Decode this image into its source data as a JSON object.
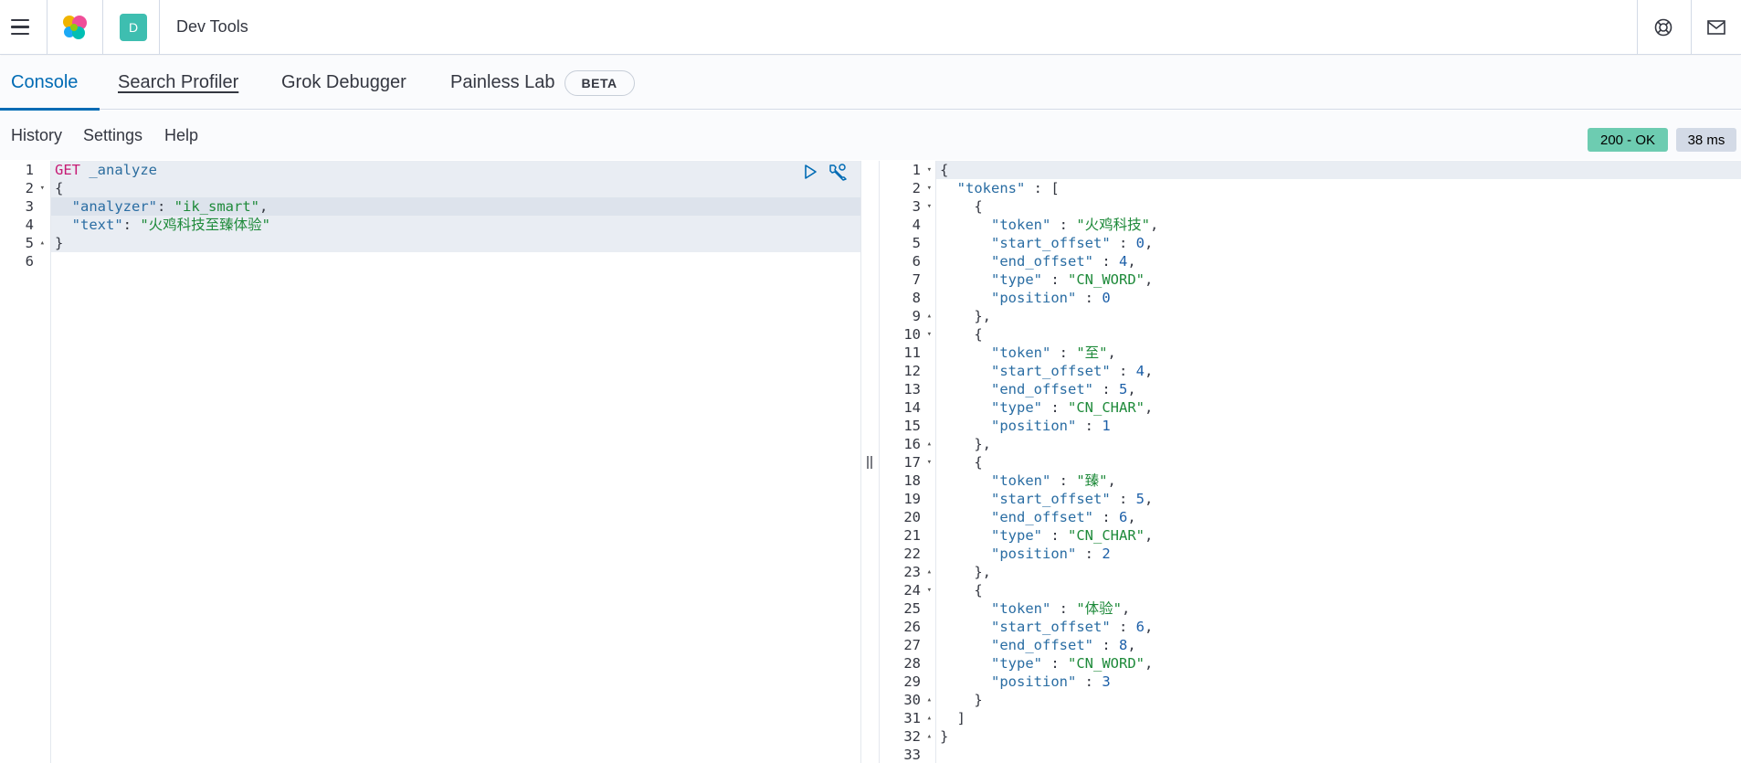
{
  "header": {
    "title": "Dev Tools",
    "space_initial": "D"
  },
  "tabs": [
    {
      "label": "Console",
      "active": true
    },
    {
      "label": "Search Profiler",
      "active": false
    },
    {
      "label": "Grok Debugger",
      "active": false
    },
    {
      "label": "Painless Lab",
      "active": false,
      "badge": "BETA"
    }
  ],
  "menu": {
    "history": "History",
    "settings": "Settings",
    "help": "Help"
  },
  "response_status": {
    "status": "200 - OK",
    "duration": "38 ms"
  },
  "colors": {
    "accent": "#006bb4",
    "status_ok": "#6dccb1",
    "space_avatar": "#3ebeb0"
  },
  "request_editor": {
    "lines": [
      [
        {
          "t": "GET",
          "c": "method"
        },
        {
          "t": " _analyze",
          "c": "path"
        }
      ],
      [
        {
          "t": "{",
          "c": "punc"
        }
      ],
      [
        {
          "t": "  ",
          "c": "punc"
        },
        {
          "t": "\"analyzer\"",
          "c": "key"
        },
        {
          "t": ": ",
          "c": "punc"
        },
        {
          "t": "\"ik_smart\"",
          "c": "str"
        },
        {
          "t": ",",
          "c": "punc"
        }
      ],
      [
        {
          "t": "  ",
          "c": "punc"
        },
        {
          "t": "\"text\"",
          "c": "key"
        },
        {
          "t": ": ",
          "c": "punc"
        },
        {
          "t": "\"火鸡科技至臻体验\"",
          "c": "str"
        }
      ],
      [
        {
          "t": "}",
          "c": "punc"
        }
      ],
      []
    ],
    "fold_lines": [
      2,
      5
    ]
  },
  "response_editor": {
    "lines": [
      [
        {
          "t": "{",
          "c": "punc"
        }
      ],
      [
        {
          "t": "  ",
          "c": "punc"
        },
        {
          "t": "\"tokens\"",
          "c": "key"
        },
        {
          "t": " : [",
          "c": "punc"
        }
      ],
      [
        {
          "t": "    {",
          "c": "punc"
        }
      ],
      [
        {
          "t": "      ",
          "c": "punc"
        },
        {
          "t": "\"token\"",
          "c": "key"
        },
        {
          "t": " : ",
          "c": "punc"
        },
        {
          "t": "\"火鸡科技\"",
          "c": "str"
        },
        {
          "t": ",",
          "c": "punc"
        }
      ],
      [
        {
          "t": "      ",
          "c": "punc"
        },
        {
          "t": "\"start_offset\"",
          "c": "key"
        },
        {
          "t": " : ",
          "c": "punc"
        },
        {
          "t": "0",
          "c": "num"
        },
        {
          "t": ",",
          "c": "punc"
        }
      ],
      [
        {
          "t": "      ",
          "c": "punc"
        },
        {
          "t": "\"end_offset\"",
          "c": "key"
        },
        {
          "t": " : ",
          "c": "punc"
        },
        {
          "t": "4",
          "c": "num"
        },
        {
          "t": ",",
          "c": "punc"
        }
      ],
      [
        {
          "t": "      ",
          "c": "punc"
        },
        {
          "t": "\"type\"",
          "c": "key"
        },
        {
          "t": " : ",
          "c": "punc"
        },
        {
          "t": "\"CN_WORD\"",
          "c": "str"
        },
        {
          "t": ",",
          "c": "punc"
        }
      ],
      [
        {
          "t": "      ",
          "c": "punc"
        },
        {
          "t": "\"position\"",
          "c": "key"
        },
        {
          "t": " : ",
          "c": "punc"
        },
        {
          "t": "0",
          "c": "num"
        }
      ],
      [
        {
          "t": "    },",
          "c": "punc"
        }
      ],
      [
        {
          "t": "    {",
          "c": "punc"
        }
      ],
      [
        {
          "t": "      ",
          "c": "punc"
        },
        {
          "t": "\"token\"",
          "c": "key"
        },
        {
          "t": " : ",
          "c": "punc"
        },
        {
          "t": "\"至\"",
          "c": "str"
        },
        {
          "t": ",",
          "c": "punc"
        }
      ],
      [
        {
          "t": "      ",
          "c": "punc"
        },
        {
          "t": "\"start_offset\"",
          "c": "key"
        },
        {
          "t": " : ",
          "c": "punc"
        },
        {
          "t": "4",
          "c": "num"
        },
        {
          "t": ",",
          "c": "punc"
        }
      ],
      [
        {
          "t": "      ",
          "c": "punc"
        },
        {
          "t": "\"end_offset\"",
          "c": "key"
        },
        {
          "t": " : ",
          "c": "punc"
        },
        {
          "t": "5",
          "c": "num"
        },
        {
          "t": ",",
          "c": "punc"
        }
      ],
      [
        {
          "t": "      ",
          "c": "punc"
        },
        {
          "t": "\"type\"",
          "c": "key"
        },
        {
          "t": " : ",
          "c": "punc"
        },
        {
          "t": "\"CN_CHAR\"",
          "c": "str"
        },
        {
          "t": ",",
          "c": "punc"
        }
      ],
      [
        {
          "t": "      ",
          "c": "punc"
        },
        {
          "t": "\"position\"",
          "c": "key"
        },
        {
          "t": " : ",
          "c": "punc"
        },
        {
          "t": "1",
          "c": "num"
        }
      ],
      [
        {
          "t": "    },",
          "c": "punc"
        }
      ],
      [
        {
          "t": "    {",
          "c": "punc"
        }
      ],
      [
        {
          "t": "      ",
          "c": "punc"
        },
        {
          "t": "\"token\"",
          "c": "key"
        },
        {
          "t": " : ",
          "c": "punc"
        },
        {
          "t": "\"臻\"",
          "c": "str"
        },
        {
          "t": ",",
          "c": "punc"
        }
      ],
      [
        {
          "t": "      ",
          "c": "punc"
        },
        {
          "t": "\"start_offset\"",
          "c": "key"
        },
        {
          "t": " : ",
          "c": "punc"
        },
        {
          "t": "5",
          "c": "num"
        },
        {
          "t": ",",
          "c": "punc"
        }
      ],
      [
        {
          "t": "      ",
          "c": "punc"
        },
        {
          "t": "\"end_offset\"",
          "c": "key"
        },
        {
          "t": " : ",
          "c": "punc"
        },
        {
          "t": "6",
          "c": "num"
        },
        {
          "t": ",",
          "c": "punc"
        }
      ],
      [
        {
          "t": "      ",
          "c": "punc"
        },
        {
          "t": "\"type\"",
          "c": "key"
        },
        {
          "t": " : ",
          "c": "punc"
        },
        {
          "t": "\"CN_CHAR\"",
          "c": "str"
        },
        {
          "t": ",",
          "c": "punc"
        }
      ],
      [
        {
          "t": "      ",
          "c": "punc"
        },
        {
          "t": "\"position\"",
          "c": "key"
        },
        {
          "t": " : ",
          "c": "punc"
        },
        {
          "t": "2",
          "c": "num"
        }
      ],
      [
        {
          "t": "    },",
          "c": "punc"
        }
      ],
      [
        {
          "t": "    {",
          "c": "punc"
        }
      ],
      [
        {
          "t": "      ",
          "c": "punc"
        },
        {
          "t": "\"token\"",
          "c": "key"
        },
        {
          "t": " : ",
          "c": "punc"
        },
        {
          "t": "\"体验\"",
          "c": "str"
        },
        {
          "t": ",",
          "c": "punc"
        }
      ],
      [
        {
          "t": "      ",
          "c": "punc"
        },
        {
          "t": "\"start_offset\"",
          "c": "key"
        },
        {
          "t": " : ",
          "c": "punc"
        },
        {
          "t": "6",
          "c": "num"
        },
        {
          "t": ",",
          "c": "punc"
        }
      ],
      [
        {
          "t": "      ",
          "c": "punc"
        },
        {
          "t": "\"end_offset\"",
          "c": "key"
        },
        {
          "t": " : ",
          "c": "punc"
        },
        {
          "t": "8",
          "c": "num"
        },
        {
          "t": ",",
          "c": "punc"
        }
      ],
      [
        {
          "t": "      ",
          "c": "punc"
        },
        {
          "t": "\"type\"",
          "c": "key"
        },
        {
          "t": " : ",
          "c": "punc"
        },
        {
          "t": "\"CN_WORD\"",
          "c": "str"
        },
        {
          "t": ",",
          "c": "punc"
        }
      ],
      [
        {
          "t": "      ",
          "c": "punc"
        },
        {
          "t": "\"position\"",
          "c": "key"
        },
        {
          "t": " : ",
          "c": "punc"
        },
        {
          "t": "3",
          "c": "num"
        }
      ],
      [
        {
          "t": "    }",
          "c": "punc"
        }
      ],
      [
        {
          "t": "  ]",
          "c": "punc"
        }
      ],
      [
        {
          "t": "}",
          "c": "punc"
        }
      ],
      []
    ],
    "fold_lines": [
      1,
      2,
      3,
      9,
      10,
      16,
      17,
      23,
      24,
      30,
      31,
      32
    ]
  }
}
